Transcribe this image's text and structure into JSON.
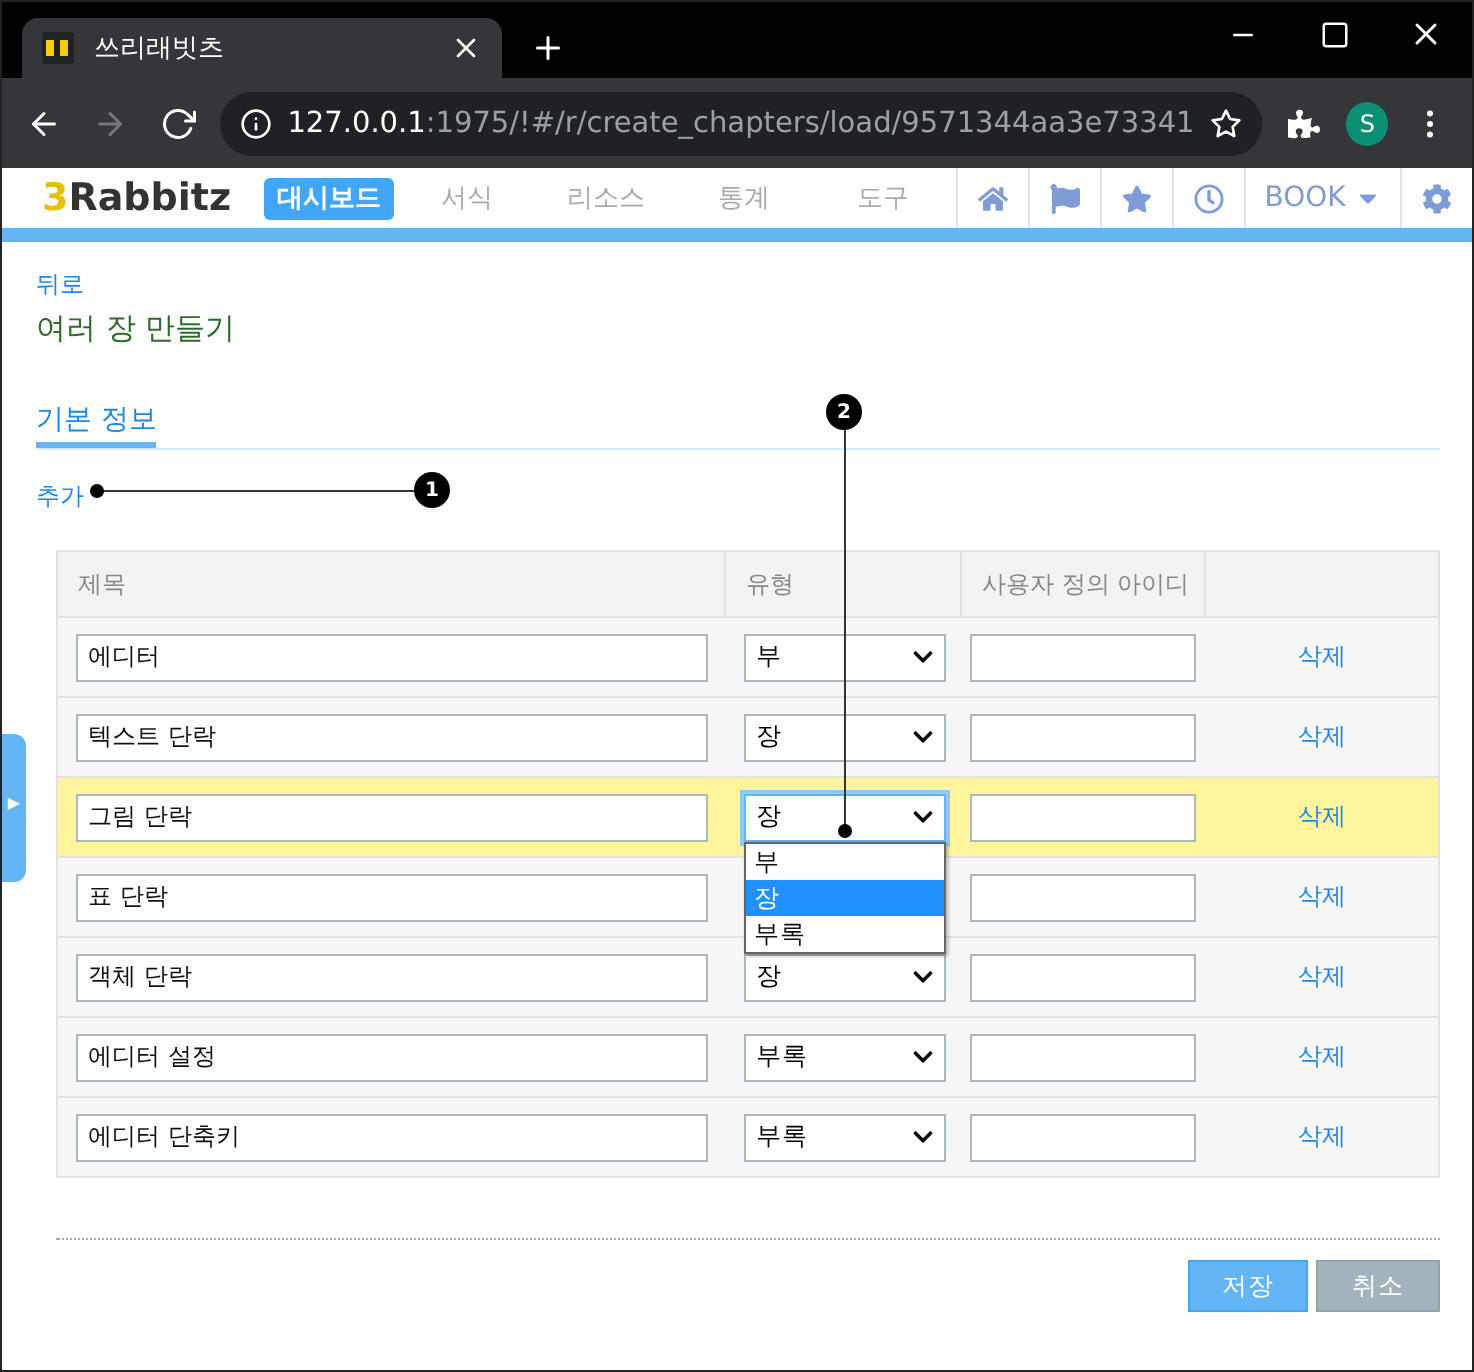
{
  "browser": {
    "tab_title": "쓰리래빗츠",
    "url_host": "127.0.0.1",
    "url_rest": ":1975/!#/r/create_chapters/load/9571344aa3e73341",
    "profile": "S"
  },
  "app": {
    "logo_mark": "3",
    "logo_text": "Rabbitz",
    "nav": [
      {
        "label": "대시보드",
        "selected": true
      },
      {
        "label": "서식",
        "selected": false
      },
      {
        "label": "리소스",
        "selected": false
      },
      {
        "label": "통계",
        "selected": false
      },
      {
        "label": "도구",
        "selected": false
      }
    ],
    "book_menu": "BOOK"
  },
  "back_link": "뒤로",
  "page_title": "여러 장 만들기",
  "section_tabs": [
    {
      "label": "기본 정보",
      "selected": true
    }
  ],
  "add_link": "추가",
  "table": {
    "columns": [
      "제목",
      "유형",
      "사용자 정의 아이디"
    ],
    "rows": [
      {
        "title": "에디터",
        "type": "부",
        "custom_id": "",
        "delete": "삭제",
        "highlighted": false
      },
      {
        "title": "텍스트 단락",
        "type": "장",
        "custom_id": "",
        "delete": "삭제",
        "highlighted": false
      },
      {
        "title": "그림 단락",
        "type": "장",
        "custom_id": "",
        "delete": "삭제",
        "highlighted": true,
        "dropdown_open": true
      },
      {
        "title": "표 단락",
        "custom_id": "",
        "delete": "삭제",
        "highlighted": false
      },
      {
        "title": "객체 단락",
        "type": "장",
        "custom_id": "",
        "delete": "삭제",
        "highlighted": false
      },
      {
        "title": "에디터 설정",
        "type": "부록",
        "custom_id": "",
        "delete": "삭제",
        "highlighted": false
      },
      {
        "title": "에디터 단축키",
        "type": "부록",
        "custom_id": "",
        "delete": "삭제",
        "highlighted": false
      }
    ]
  },
  "dropdown": {
    "options": [
      {
        "label": "부",
        "selected": false
      },
      {
        "label": "장",
        "selected": true
      },
      {
        "label": "부록",
        "selected": false
      }
    ]
  },
  "callouts": [
    "1",
    "2"
  ],
  "sidebar_handle": "▶",
  "buttons": [
    {
      "label": "저장",
      "kind": "primary"
    },
    {
      "label": "취소",
      "kind": "secondary"
    }
  ]
}
